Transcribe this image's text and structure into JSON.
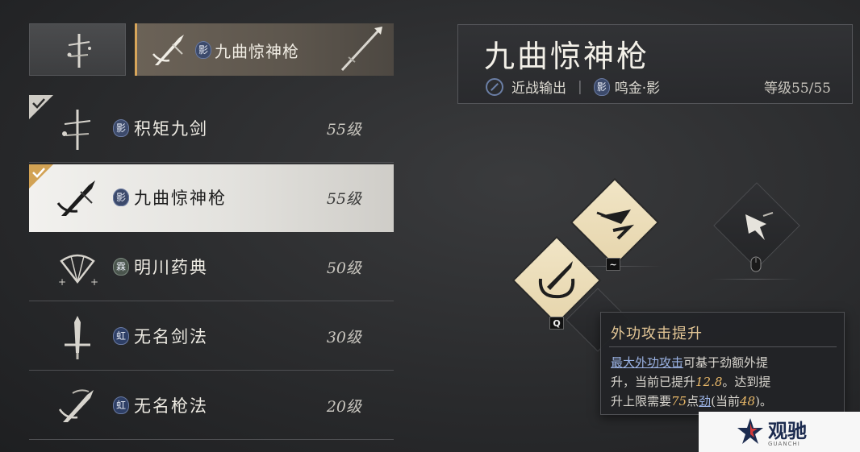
{
  "tabs": {
    "selected_badge": "影",
    "selected_name": "九曲惊神枪"
  },
  "styles": [
    {
      "badge": "影",
      "name": "积矩九剑",
      "level": "55级",
      "checked": true
    },
    {
      "badge": "影",
      "name": "九曲惊神枪",
      "level": "55级",
      "checked": true,
      "active": true
    },
    {
      "badge": "霖",
      "name": "明川药典",
      "level": "50级"
    },
    {
      "badge": "虹",
      "name": "无名剑法",
      "level": "30级"
    },
    {
      "badge": "虹",
      "name": "无名枪法",
      "level": "20级"
    }
  ],
  "info": {
    "title": "九曲惊神枪",
    "role_icon": "no-entry-circle-icon",
    "role": "近战输出",
    "separator": "|",
    "school_badge": "影",
    "school": "鸣金·影",
    "level": "等级55/55"
  },
  "skills": {
    "key_q": "Q",
    "key_tilde": "~"
  },
  "tooltip": {
    "title": "外功攻击提升",
    "line1_link": "最大外功攻击",
    "line1_rest": "可基于劲额外提",
    "line2_a": "升，当前已提升",
    "line2_num": "12.8",
    "line2_b": "。达到提",
    "line3_a": "升上限需要",
    "line3_num": "75",
    "line3_b": "点",
    "line3_link": "劲",
    "line3_c": "(当前",
    "line3_num2": "48",
    "line3_d": ")。"
  },
  "watermark": {
    "name": "观驰",
    "sub": "GUANCHI"
  },
  "colors": {
    "accent": "#d7a55a",
    "tooltip_title": "#e4c796",
    "link": "#9cb4e6",
    "number": "#e7b768"
  }
}
